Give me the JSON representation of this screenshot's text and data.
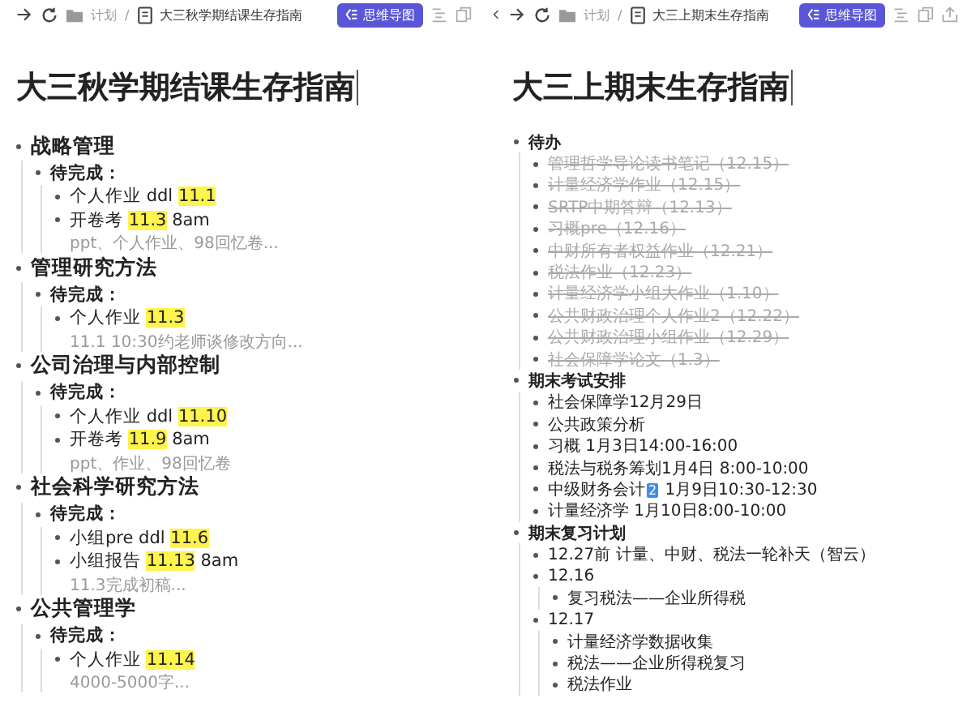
{
  "panels": [
    {
      "breadcrumb": {
        "folder": "计划",
        "separator": "/",
        "document": "大三秋学期结课生存指南"
      },
      "mindmap_button": "思维导图",
      "title": "大三秋学期结课生存指南",
      "outline": [
        {
          "kind": "heading",
          "text": "战略管理",
          "children": [
            {
              "kind": "label",
              "text": "待完成：",
              "children": [
                {
                  "kind": "item",
                  "text": "个人作业 ddl ",
                  "highlight": "11.1"
                },
                {
                  "kind": "item",
                  "text": "开卷考 ",
                  "highlight": "11.3",
                  "after": " 8am",
                  "note": "ppt、个人作业、98回忆卷..."
                }
              ]
            }
          ]
        },
        {
          "kind": "heading",
          "text": "管理研究方法",
          "children": [
            {
              "kind": "label",
              "text": "待完成：",
              "children": [
                {
                  "kind": "item",
                  "text": "个人作业 ",
                  "highlight": "11.3",
                  "note": "11.1 10:30约老师谈修改方向..."
                }
              ]
            }
          ]
        },
        {
          "kind": "heading",
          "text": "公司治理与内部控制",
          "children": [
            {
              "kind": "label",
              "text": "待完成：",
              "children": [
                {
                  "kind": "item",
                  "text": "个人作业 ddl ",
                  "highlight": "11.10"
                },
                {
                  "kind": "item",
                  "text": "开卷考 ",
                  "highlight": "11.9",
                  "after": " 8am",
                  "note": "ppt、作业、98回忆卷"
                }
              ]
            }
          ]
        },
        {
          "kind": "heading",
          "text": "社会科学研究方法",
          "children": [
            {
              "kind": "label",
              "text": "待完成：",
              "children": [
                {
                  "kind": "item",
                  "text": "小组pre ddl ",
                  "highlight": "11.6"
                },
                {
                  "kind": "item",
                  "text": "小组报告 ",
                  "highlight": "11.13",
                  "after": " 8am",
                  "note": "11.3完成初稿..."
                }
              ]
            }
          ]
        },
        {
          "kind": "heading",
          "text": "公共管理学",
          "children": [
            {
              "kind": "label",
              "text": "待完成：",
              "children": [
                {
                  "kind": "item",
                  "text": "个人作业 ",
                  "highlight": "11.14",
                  "note": "4000-5000字..."
                }
              ]
            }
          ]
        }
      ]
    },
    {
      "breadcrumb": {
        "folder": "计划",
        "separator": "/",
        "document": "大三上期末生存指南"
      },
      "mindmap_button": "思维导图",
      "title": "大三上期末生存指南",
      "outline": [
        {
          "kind": "section",
          "text": "待办",
          "children": [
            {
              "kind": "task",
              "text": "管理哲学导论读书笔记（12.15）",
              "done": true
            },
            {
              "kind": "task",
              "text": "计量经济学作业（12.15）",
              "done": true
            },
            {
              "kind": "task",
              "text": "SRTP中期答辩（12.13）",
              "done": true
            },
            {
              "kind": "task",
              "text": "习概pre（12.16）",
              "done": true
            },
            {
              "kind": "task",
              "text": "中财所有者权益作业（12.21）",
              "done": true
            },
            {
              "kind": "task",
              "text": "税法作业（12.23）",
              "done": true
            },
            {
              "kind": "task",
              "text": "计量经济学小组大作业（1.10）",
              "done": true
            },
            {
              "kind": "task",
              "text": "公共财政治理个人作业2（12.22）",
              "done": true
            },
            {
              "kind": "task",
              "text": "公共财政治理小组作业（12.29）",
              "done": true
            },
            {
              "kind": "task",
              "text": "社会保障学论文（1.3）",
              "done": true
            }
          ]
        },
        {
          "kind": "section",
          "text": "期末考试安排",
          "children": [
            {
              "kind": "task",
              "text": "社会保障学12月29日"
            },
            {
              "kind": "task",
              "text": "公共政策分析"
            },
            {
              "kind": "task",
              "text": "习概 1月3日14:00-16:00"
            },
            {
              "kind": "task",
              "text": "税法与税务筹划1月4日 8:00-10:00"
            },
            {
              "kind": "task",
              "text": "中级财务会计",
              "key": "2",
              "after": " 1月9日10:30-12:30"
            },
            {
              "kind": "task",
              "text": "计量经济学 1月10日8:00-10:00"
            }
          ]
        },
        {
          "kind": "section",
          "text": "期末复习计划",
          "children": [
            {
              "kind": "task",
              "text": "12.27前 计量、中财、税法一轮补天（智云）"
            },
            {
              "kind": "task",
              "text": "12.16",
              "children": [
                {
                  "kind": "task",
                  "text": "复习税法——企业所得税"
                }
              ]
            },
            {
              "kind": "task",
              "text": "12.17",
              "children": [
                {
                  "kind": "task",
                  "text": "计量经济学数据收集"
                },
                {
                  "kind": "task",
                  "text": "税法——企业所得税复习"
                },
                {
                  "kind": "task",
                  "text": "税法作业"
                }
              ]
            }
          ]
        }
      ]
    }
  ]
}
